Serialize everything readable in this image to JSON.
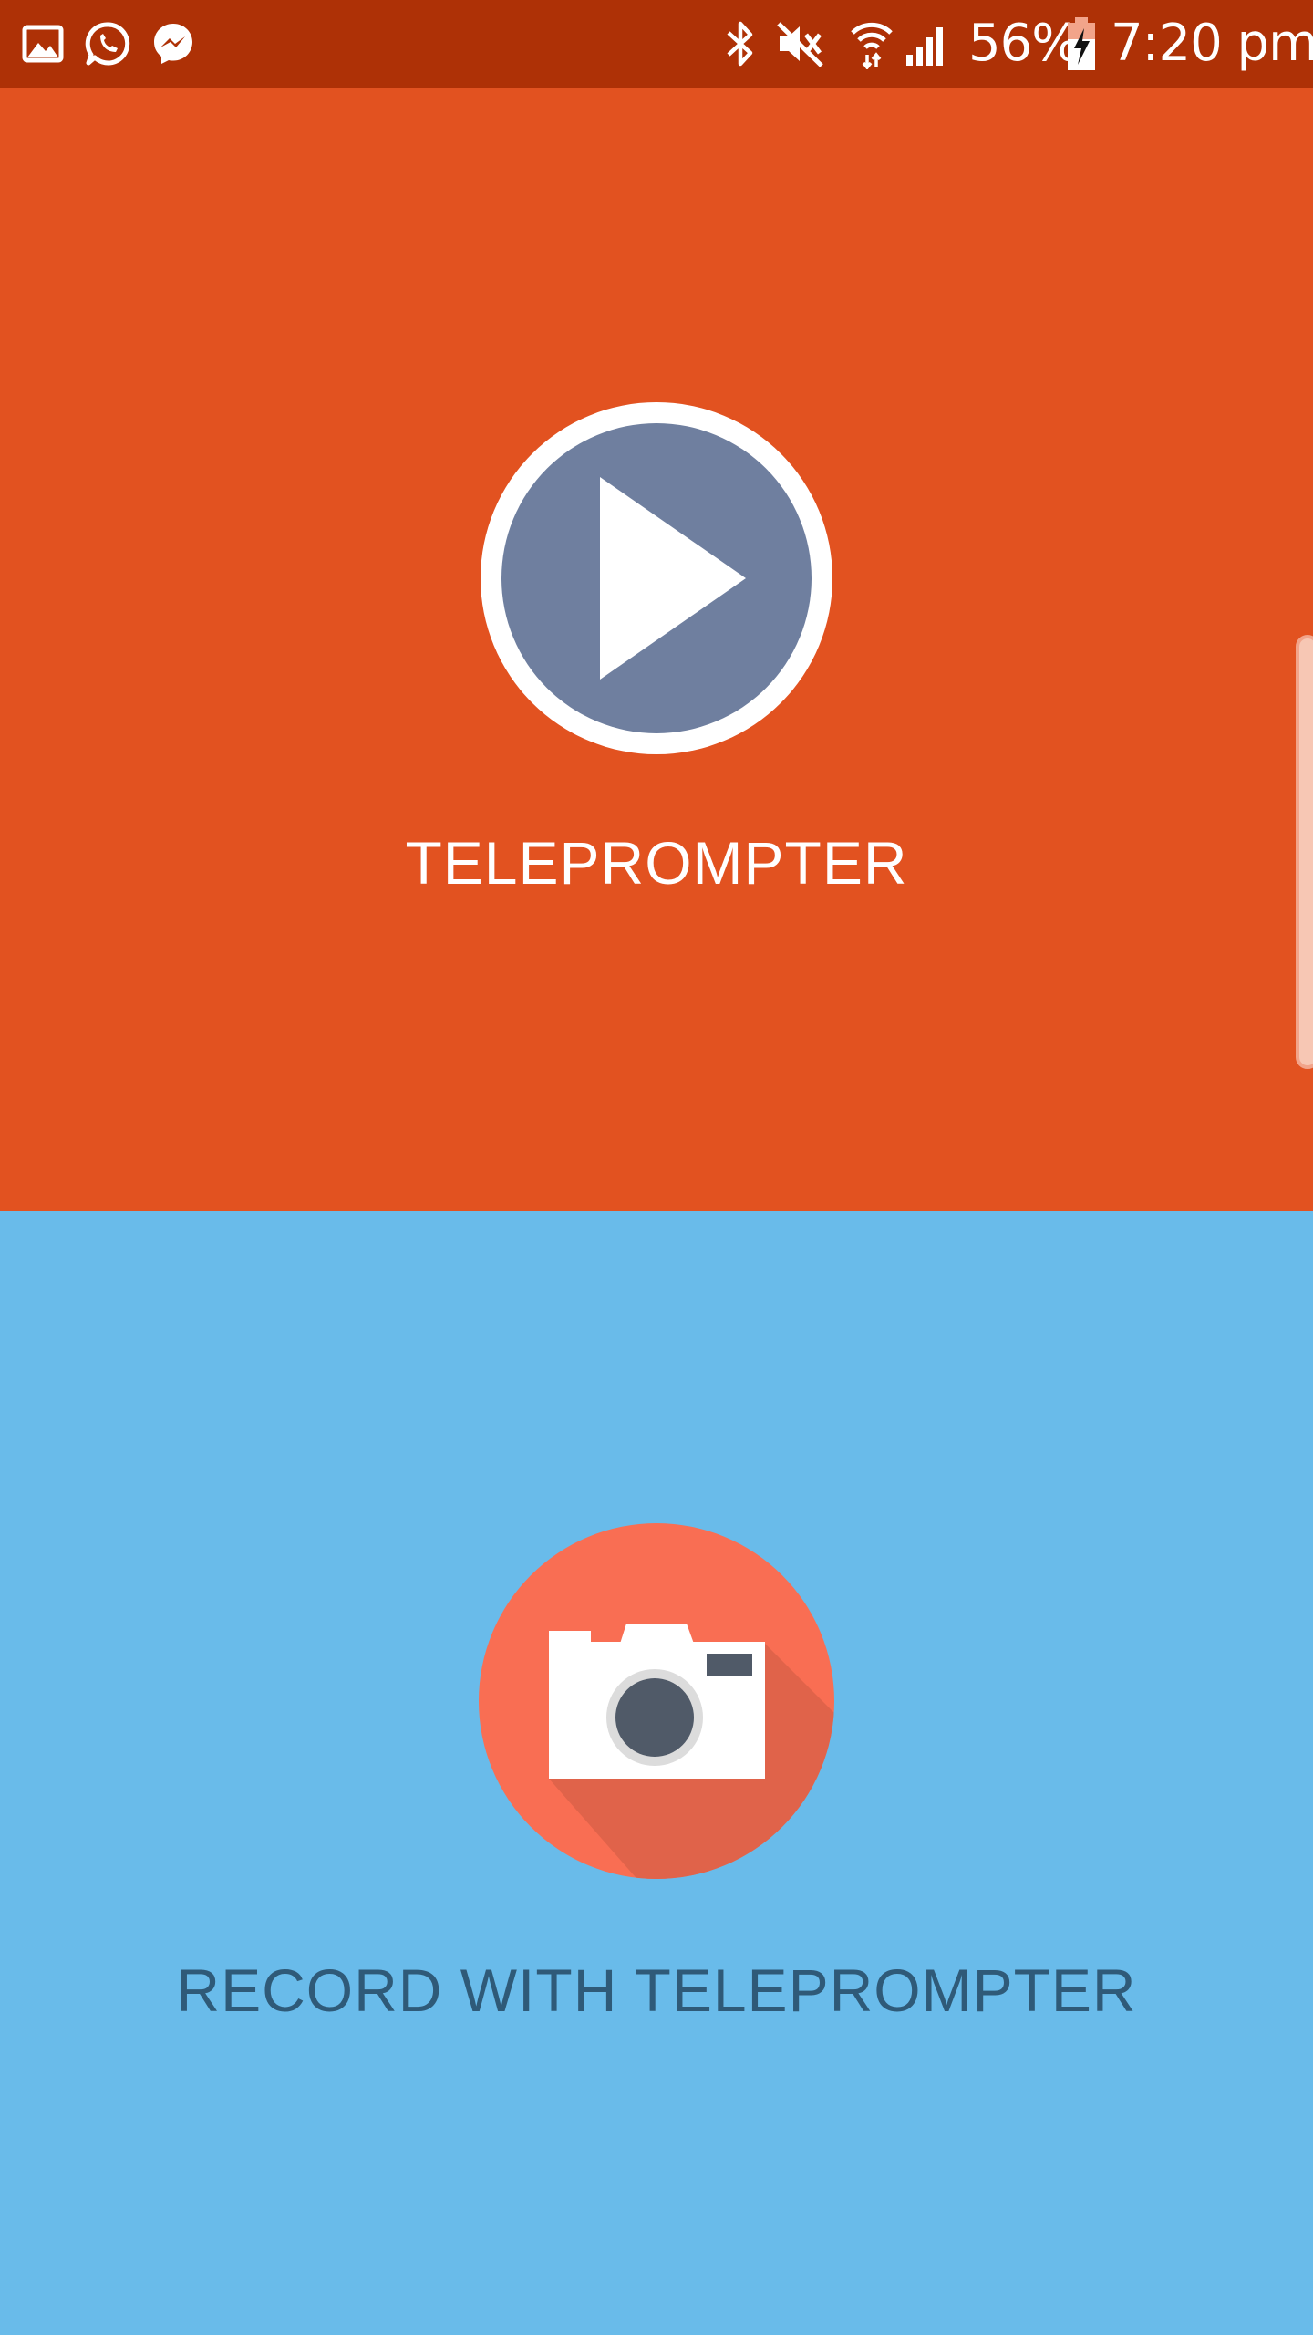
{
  "status_bar": {
    "notification_icons": [
      "gallery-icon",
      "whatsapp-icon",
      "messenger-icon"
    ],
    "system_icons": [
      "bluetooth-icon",
      "mute-icon",
      "wifi-icon",
      "signal-icon",
      "battery-charging-icon"
    ],
    "battery_percent": "56%",
    "time": "7:20 pm"
  },
  "colors": {
    "status_bar_bg": "#AE3106",
    "top_panel_bg": "#E25220",
    "bottom_panel_bg": "#69BBEA",
    "play_circle_fill": "#6F7F9F",
    "camera_circle_fill": "#F96E53",
    "bottom_label_color": "#2F5A78"
  },
  "panels": {
    "teleprompter": {
      "icon": "play-icon",
      "label": "TELEPROMPTER"
    },
    "record": {
      "icon": "camera-icon",
      "label": "RECORD WITH TELEPROMPTER"
    }
  }
}
